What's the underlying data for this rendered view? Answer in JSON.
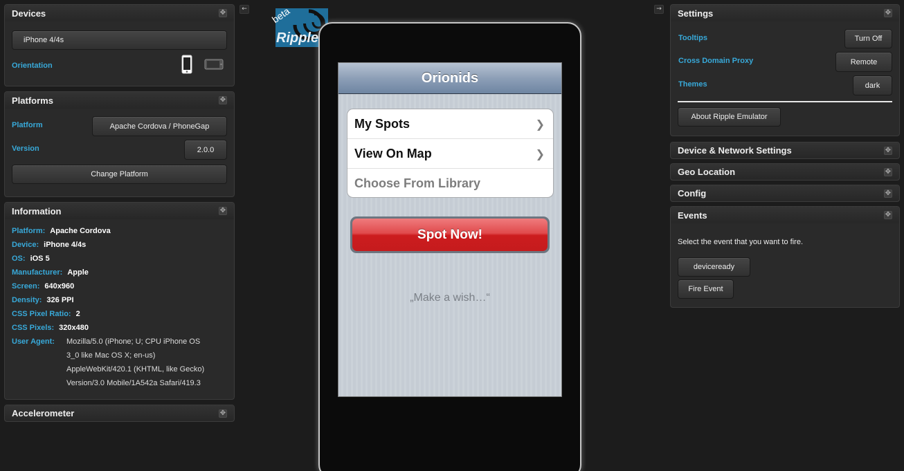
{
  "left": {
    "devices": {
      "title": "Devices",
      "device_button": "iPhone 4/4s",
      "orientation_label": "Orientation"
    },
    "platforms": {
      "title": "Platforms",
      "platform_label": "Platform",
      "platform_value": "Apache Cordova / PhoneGap",
      "version_label": "Version",
      "version_value": "2.0.0",
      "change_button": "Change Platform"
    },
    "information": {
      "title": "Information",
      "rows": [
        {
          "key": "Platform:",
          "value": "Apache Cordova"
        },
        {
          "key": "Device:",
          "value": "iPhone 4/4s"
        },
        {
          "key": "OS:",
          "value": "iOS 5"
        },
        {
          "key": "Manufacturer:",
          "value": "Apple"
        },
        {
          "key": "Screen:",
          "value": "640x960"
        },
        {
          "key": "Density:",
          "value": "326 PPI"
        },
        {
          "key": "CSS Pixel Ratio:",
          "value": "2"
        },
        {
          "key": "CSS Pixels:",
          "value": "320x480"
        }
      ],
      "user_agent_label": "User Agent:",
      "user_agent_lines": [
        "Mozilla/5.0 (iPhone; U; CPU iPhone OS",
        "3_0 like Mac OS X; en-us)",
        "AppleWebKit/420.1 (KHTML, like Gecko)",
        "Version/3.0 Mobile/1A542a Safari/419.3"
      ]
    },
    "accelerometer": {
      "title": "Accelerometer"
    }
  },
  "logo": {
    "beta": "beta",
    "name": "Ripple"
  },
  "phone": {
    "nav_title": "Orionids",
    "list": [
      {
        "label": "My Spots",
        "chevron": true,
        "disabled": false
      },
      {
        "label": "View On Map",
        "chevron": true,
        "disabled": false
      },
      {
        "label": "Choose From Library",
        "chevron": false,
        "disabled": true
      }
    ],
    "chevron_glyph": "❯",
    "spot_button": "Spot Now!",
    "wish_text": "„Make a wish…“"
  },
  "right": {
    "settings": {
      "title": "Settings",
      "tooltips_label": "Tooltips",
      "tooltips_button": "Turn Off",
      "proxy_label": "Cross Domain Proxy",
      "proxy_button": "Remote",
      "themes_label": "Themes",
      "themes_button": "dark",
      "about_button": "About Ripple Emulator"
    },
    "device_network": {
      "title": "Device & Network Settings"
    },
    "geo": {
      "title": "Geo Location"
    },
    "config": {
      "title": "Config"
    },
    "events": {
      "title": "Events",
      "description": "Select the event that you want to fire.",
      "selected_event": "deviceready",
      "fire_button": "Fire Event"
    }
  },
  "icons": {
    "move": "✥",
    "arrow_left": "←",
    "arrow_right": "→"
  },
  "colors": {
    "label_accent": "#38a9d9",
    "background": "#1c1c1c",
    "spot_button_red": "#d42325"
  }
}
